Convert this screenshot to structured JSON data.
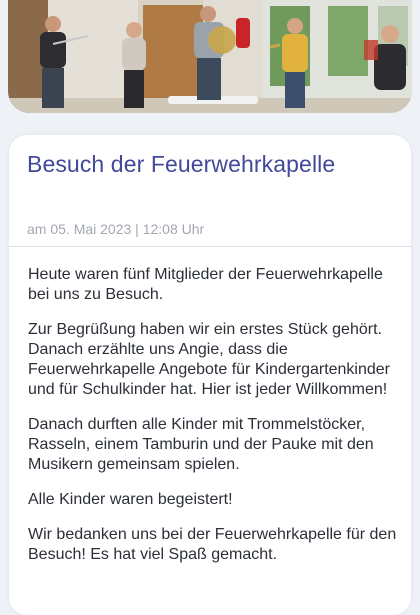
{
  "article": {
    "title": "Besuch der Feuerwehrkapelle",
    "meta": "am 05. Mai 2023 | 12:08 Uhr",
    "paragraphs": [
      "Heute waren fünf Mitglieder der Feuerwehrkapelle bei uns zu Besuch.",
      "Zur Begrüßung haben wir ein erstes Stück gehört. Danach erzählte uns Angie, dass die Feuerwehrkapelle Angebote für Kindergartenkinder und für Schulkinder hat. Hier ist jeder Willkommen!",
      "Danach durften alle Kinder mit Trommelstöcker, Rasseln, einem Tamburin und der Pauke mit den Musikern gemeinsam spielen.",
      "Alle Kinder waren begeistert!",
      "Wir bedanken uns bei der Feuerwehrkapelle für den Besuch! Es hat viel Spaß gemacht."
    ]
  },
  "colors": {
    "title": "#43499a",
    "meta": "#a3a7b2",
    "text": "#2b2f38",
    "background": "#eef1f6"
  }
}
